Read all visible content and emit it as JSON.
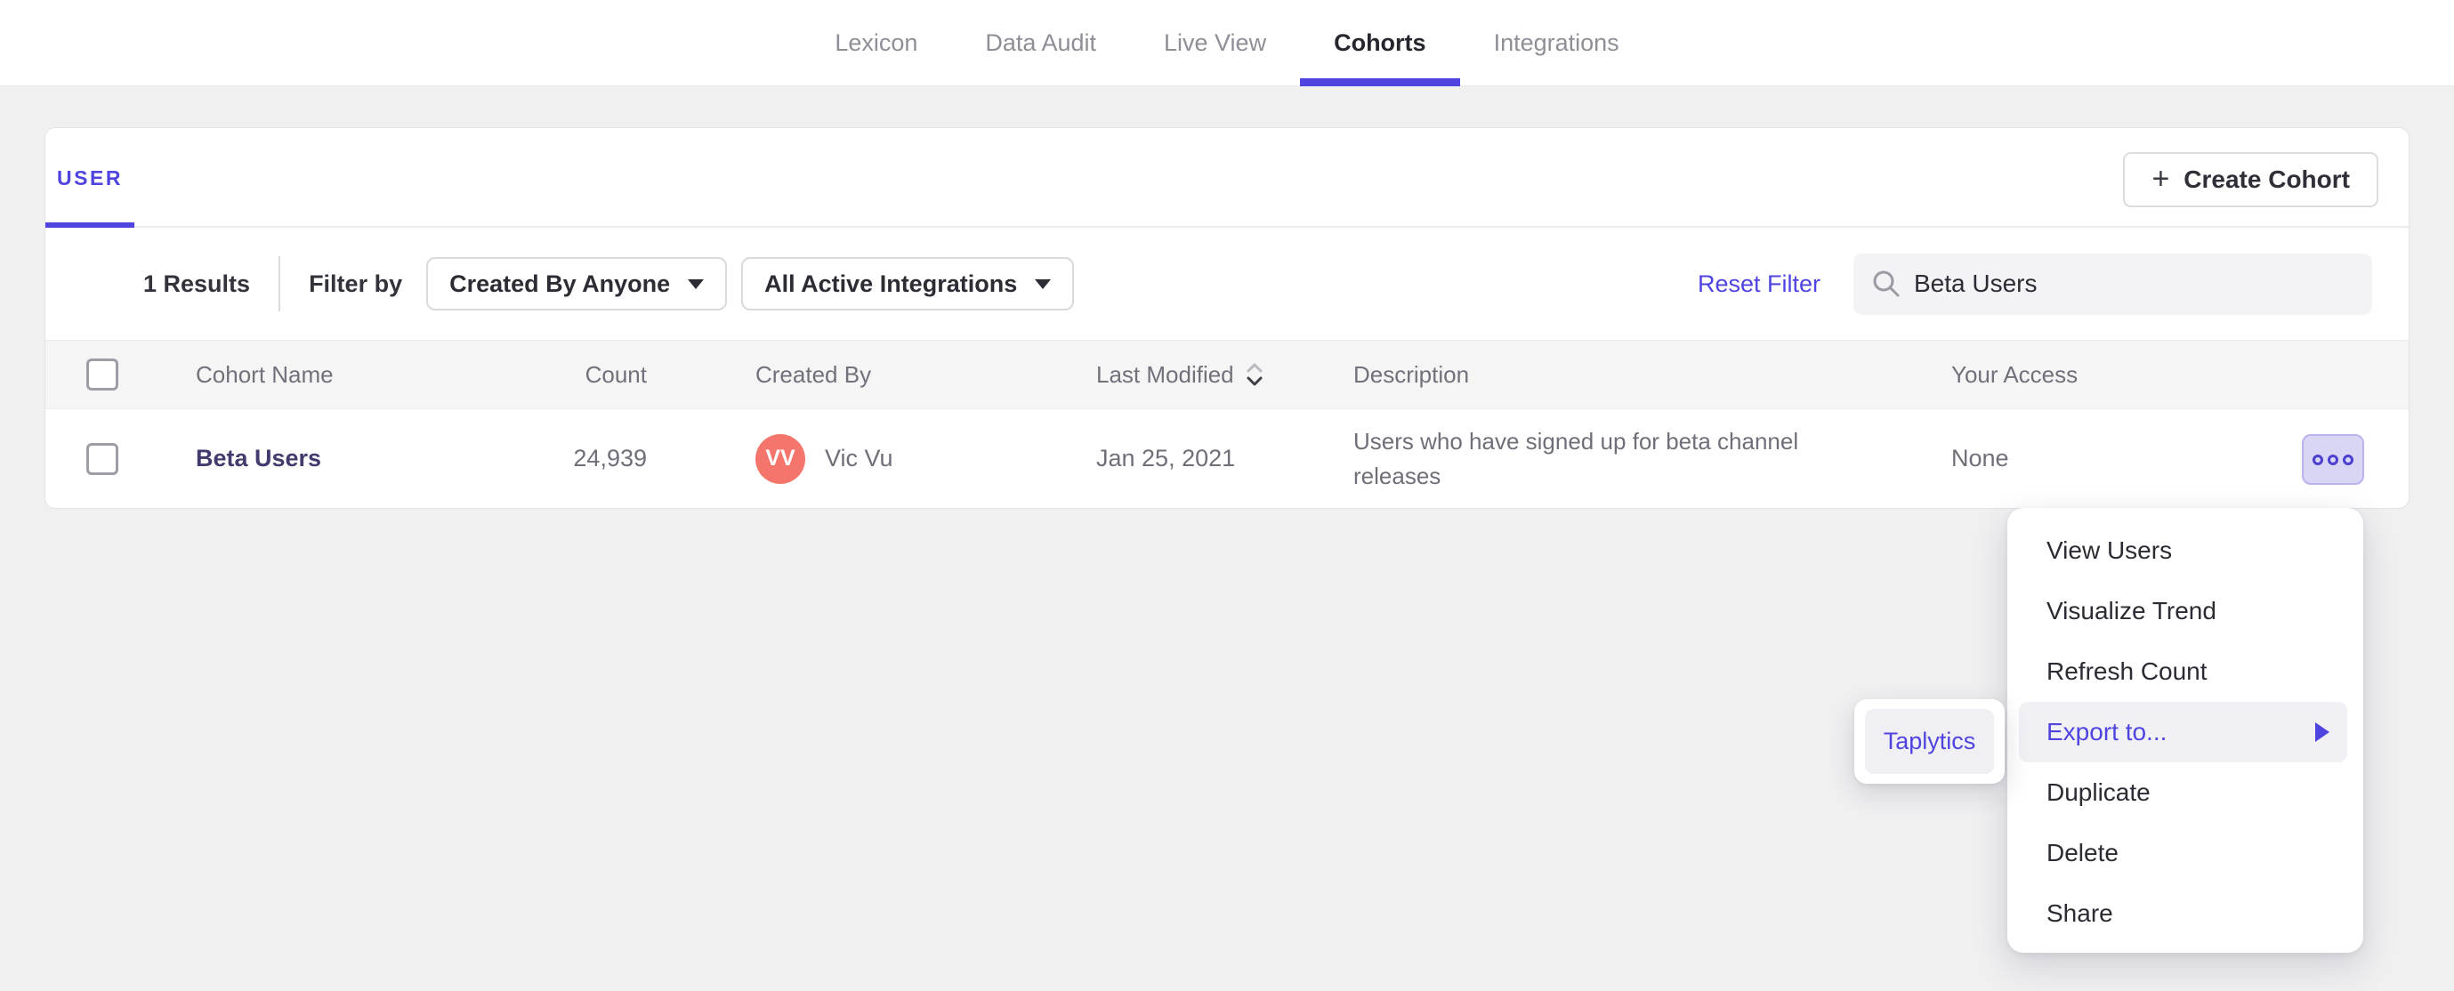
{
  "nav": {
    "items": [
      {
        "label": "Lexicon"
      },
      {
        "label": "Data Audit"
      },
      {
        "label": "Live View"
      },
      {
        "label": "Cohorts"
      },
      {
        "label": "Integrations"
      }
    ],
    "active": "Cohorts"
  },
  "card": {
    "tab_label": "USER",
    "create_button": {
      "icon": "+",
      "label": "Create Cohort"
    },
    "filter_bar": {
      "results_count": "1 Results",
      "filter_by_label": "Filter by",
      "created_by_dropdown": "Created By Anyone",
      "integrations_dropdown": "All Active Integrations",
      "reset_link": "Reset Filter",
      "search_value": "Beta Users"
    },
    "table": {
      "headers": {
        "name": "Cohort Name",
        "count": "Count",
        "created_by": "Created By",
        "last_modified": "Last Modified",
        "description": "Description",
        "access": "Your Access"
      },
      "row": {
        "name": "Beta Users",
        "count": "24,939",
        "avatar_initials": "VV",
        "created_by": "Vic Vu",
        "last_modified": "Jan 25, 2021",
        "description": "Users who have signed up for beta channel releases",
        "access": "None"
      }
    }
  },
  "context_menu": {
    "items": [
      "View Users",
      "Visualize Trend",
      "Refresh Count",
      "Export to...",
      "Duplicate",
      "Delete",
      "Share"
    ],
    "highlighted_item": "Export to...",
    "submenu": {
      "items": [
        "Taplytics"
      ],
      "highlighted_item": "Taplytics"
    }
  },
  "colors": {
    "accent_purple": "#4f44e0",
    "avatar_coral": "#f4756b",
    "page_background": "#f0f0f1",
    "header_row_background": "#f5f5f6",
    "menu_highlight": "#f1f0f5",
    "menu_button_background": "#d9d6f5"
  }
}
